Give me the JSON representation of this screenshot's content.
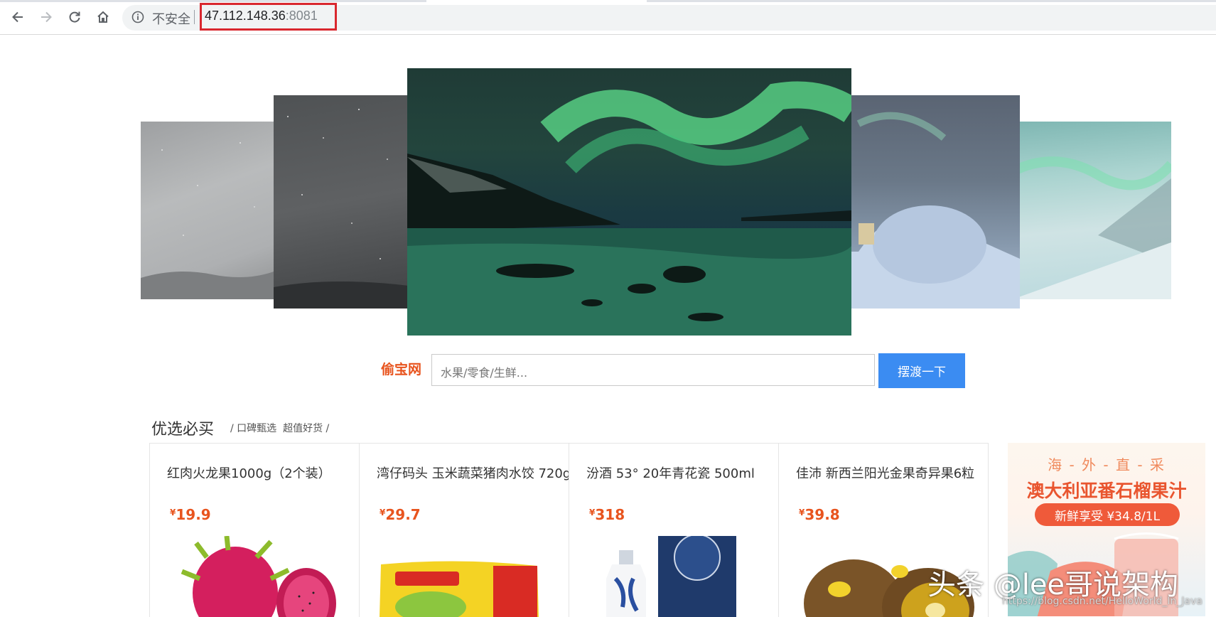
{
  "browser": {
    "security_label": "不安全",
    "url_host": "47.112.148.36",
    "url_port": ":8081",
    "icons": [
      "back-icon",
      "forward-icon",
      "reload-icon",
      "home-icon",
      "info-icon"
    ]
  },
  "carousel": {
    "slides": [
      "milky-way-sky",
      "starry-sky",
      "aurora-over-lake",
      "ice-igloo-aurora",
      "aurora-snow-valley"
    ],
    "active_index": 2
  },
  "search": {
    "brand": "偷宝网",
    "placeholder": "水果/零食/生鲜...",
    "button_label": "摆渡一下"
  },
  "section": {
    "title": "优选必买",
    "subtitle": "/ 口碑甄选  超值好货 /"
  },
  "products": [
    {
      "name": "红肉火龙果1000g（2个装）",
      "currency": "¥",
      "price": "19.9",
      "image": "dragon-fruit-image"
    },
    {
      "name": "湾仔码头 玉米蔬菜猪肉水饺 720g",
      "currency": "¥",
      "price": "29.7",
      "image": "dumpling-pack-image"
    },
    {
      "name": "汾酒 53°  20年青花瓷 500ml",
      "currency": "¥",
      "price": "318",
      "image": "fen-liquor-image"
    },
    {
      "name": "佳沛  新西兰阳光金果奇异果6粒",
      "currency": "¥",
      "price": "39.8",
      "image": "kiwi-fruit-image"
    }
  ],
  "ad": {
    "line1": "海 - 外 - 直 - 采",
    "line2": "澳大利亚番石榴果汁",
    "pill": "新鲜享受 ¥34.8/1L"
  },
  "watermark": {
    "text": "头条 @lee哥说架构",
    "url": "https://blog.csdn.net/HelloWorld_In_Java"
  },
  "colors": {
    "accent_orange": "#e8541e",
    "button_blue": "#3b8cf2",
    "highlight_red": "#d9272e"
  }
}
